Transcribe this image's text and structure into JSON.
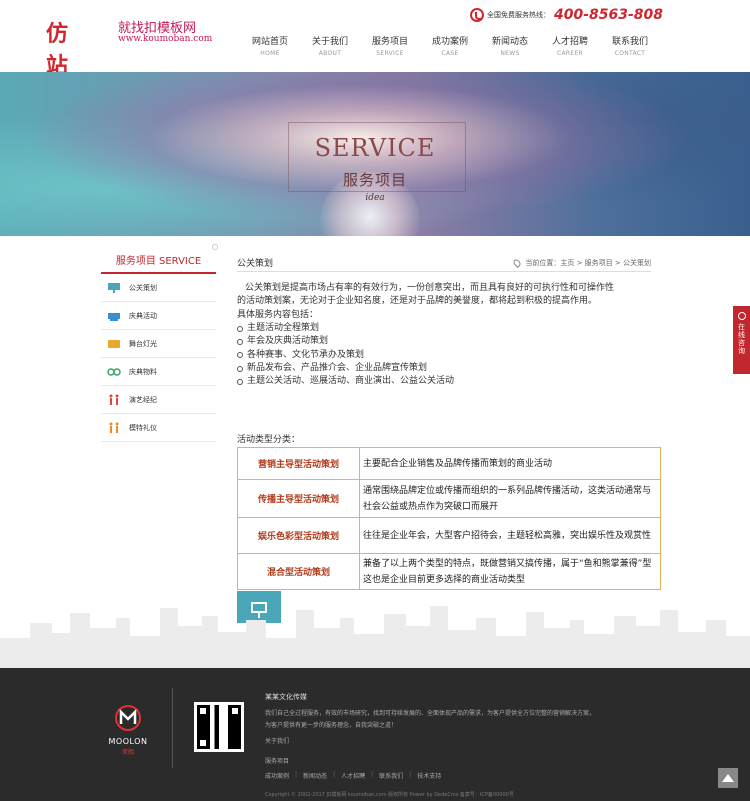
{
  "header": {
    "logo_main": "仿站",
    "logo_sub": "就找扣模板网",
    "logo_url": "www.koumoban.com",
    "hotline_label": "全国免费服务热线：",
    "hotline_number": "400-8563-808",
    "nav": [
      {
        "cn": "网站首页",
        "en": "HOME"
      },
      {
        "cn": "关于我们",
        "en": "ABOUT"
      },
      {
        "cn": "服务项目",
        "en": "SERVICE"
      },
      {
        "cn": "成功案例",
        "en": "CASE"
      },
      {
        "cn": "新闻动态",
        "en": "NEWS"
      },
      {
        "cn": "人才招聘",
        "en": "CAREER"
      },
      {
        "cn": "联系我们",
        "en": "CONTACT"
      }
    ]
  },
  "banner": {
    "title": "SERVICE",
    "subtitle": "服务项目",
    "idea": "idea"
  },
  "sidebar": {
    "heading": "服务项目 SERVICE",
    "items": [
      {
        "label": "公关策划",
        "icon": "presentation-icon"
      },
      {
        "label": "庆典活动",
        "icon": "celebration-icon"
      },
      {
        "label": "舞台灯光",
        "icon": "stage-light-icon"
      },
      {
        "label": "庆典物料",
        "icon": "materials-icon"
      },
      {
        "label": "演艺经纪",
        "icon": "performer-icon"
      },
      {
        "label": "模特礼仪",
        "icon": "model-icon"
      }
    ]
  },
  "content": {
    "title": "公关策划",
    "breadcrumb": "当前位置：主页 > 服务项目 > 公关策划",
    "intro_1": "公关策划是提高市场占有率的有效行为，一份创意突出，而且具有良好的可执行性和可操作性",
    "intro_2": "的活动策划案，无论对于企业知名度，还是对于品牌的美誉度，都将起到积极的提高作用。",
    "intro_3": "具体服务内容包括：",
    "bullets": [
      "主题活动全程策划",
      "年会及庆典活动策划",
      "各种赛事、文化节承办及策划",
      "新品发布会、产品推介会、企业品牌宣传策划",
      "主题公关活动、巡展活动、商业演出、公益公关活动"
    ],
    "type_label": "活动类型分类：",
    "types": [
      {
        "name": "营销主导型活动策划",
        "desc": "主要配合企业销售及品牌传播而策划的商业活动"
      },
      {
        "name": "传播主导型活动策划",
        "desc": "通常围绕品牌定位或传播而组织的一系列品牌传播活动，这类活动通常与社会公益或热点作为突破口而展开"
      },
      {
        "name": "娱乐色彩型活动策划",
        "desc": "往往是企业年会，大型客户招待会，主题轻松高雅，突出娱乐性及观赏性"
      },
      {
        "name": "混合型活动策划",
        "desc": "兼备了以上两个类型的特点，既做营销又搞传播，属于“鱼和熊掌兼得”型这也是企业目前更多选择的商业活动类型"
      }
    ]
  },
  "float_consult": "在线咨询",
  "footer": {
    "logo_name": "MOOLON",
    "logo_cn": "茉朗",
    "company": "某某文化传媒",
    "desc": "我们自己全过程服务，有效的市场研究，找到可持续发展的、全面体现产品的需求，为客户提供全方位完整的营销解决方案，为客户提供有更一步的服务理念，自我突破之道！",
    "about": "关于我们",
    "links_title": "服务项目",
    "links": [
      "成功案例",
      "新闻动态",
      "人才招聘",
      "联系我们",
      "技术支持"
    ],
    "copyright": "Copyright © 2002-2017 扣模板网 koumoban.com 版权所有 Power by DedeCms 备案号：ICP备00000号"
  },
  "colors": {
    "accent": "#c1272d",
    "table_border": "#e6b34d",
    "type_name": "#b03a1a",
    "footer_bg": "#2b2b2b"
  }
}
